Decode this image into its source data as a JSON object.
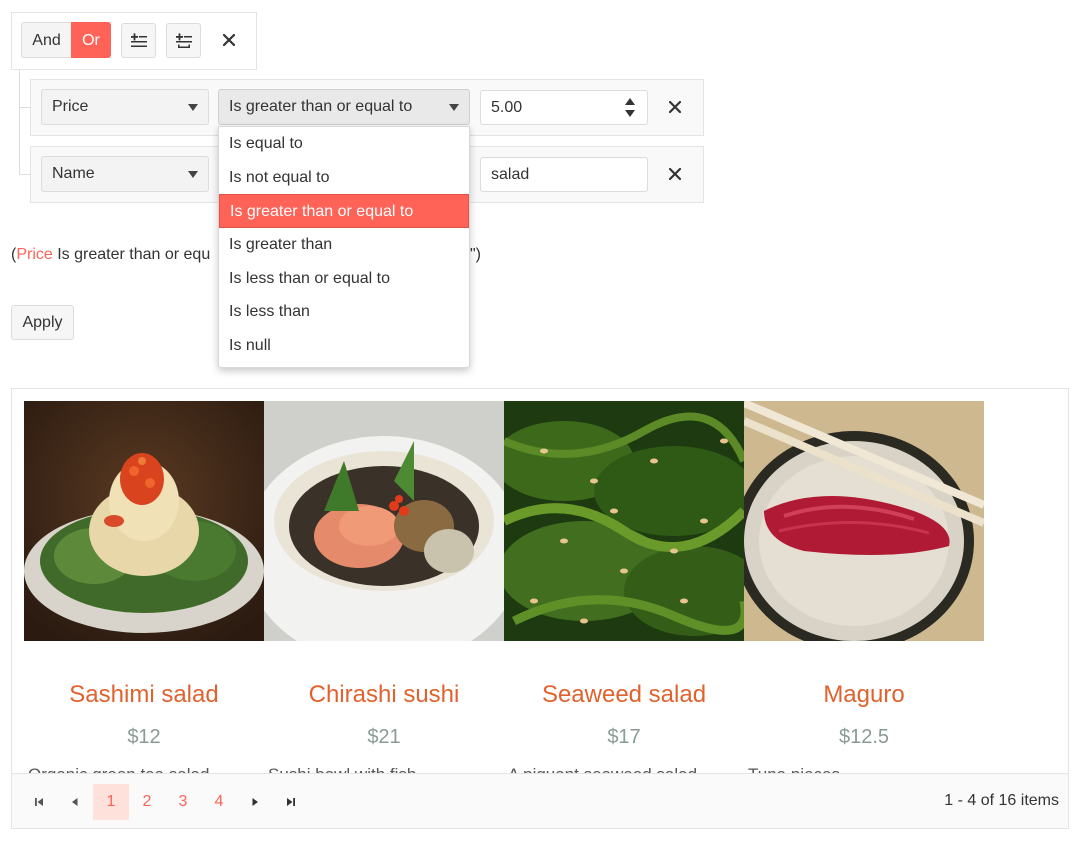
{
  "toolbar": {
    "and_label": "And",
    "or_label": "Or",
    "active_logic": "Or",
    "accent_color": "#ff6358"
  },
  "filters": [
    {
      "field": "Price",
      "operator": "Is greater than or equal to",
      "value": "5.00"
    },
    {
      "field": "Name",
      "operator": "",
      "value": "salad"
    }
  ],
  "operator_options": [
    "Is equal to",
    "Is not equal to",
    "Is greater than or equal to",
    "Is greater than",
    "Is less than or equal to",
    "Is less than",
    "Is null"
  ],
  "selected_operator": "Is greater than or equal to",
  "expression": {
    "open_paren": "(",
    "field": "Price",
    "text_before_popup": " Is greater than or equ",
    "text_after_popup": "\")"
  },
  "apply_label": "Apply",
  "products": [
    {
      "name": "Sashimi salad",
      "price": "$12",
      "desc": "Organic green tea salad"
    },
    {
      "name": "Chirashi sushi",
      "price": "$21",
      "desc": "Sushi bowl with fish"
    },
    {
      "name": "Seaweed salad",
      "price": "$17",
      "desc": "A piquant seaweed salad"
    },
    {
      "name": "Maguro",
      "price": "$12.5",
      "desc": "Tuna pieces"
    }
  ],
  "pager": {
    "pages": [
      "1",
      "2",
      "3",
      "4"
    ],
    "current_page": "1",
    "info": "1 - 4 of 16 items"
  },
  "icons": {
    "add_expression": "add-expression-icon",
    "add_group": "add-group-icon",
    "close": "close-icon",
    "first": "first-page-icon",
    "prev": "prev-page-icon",
    "next": "next-page-icon",
    "last": "last-page-icon"
  }
}
